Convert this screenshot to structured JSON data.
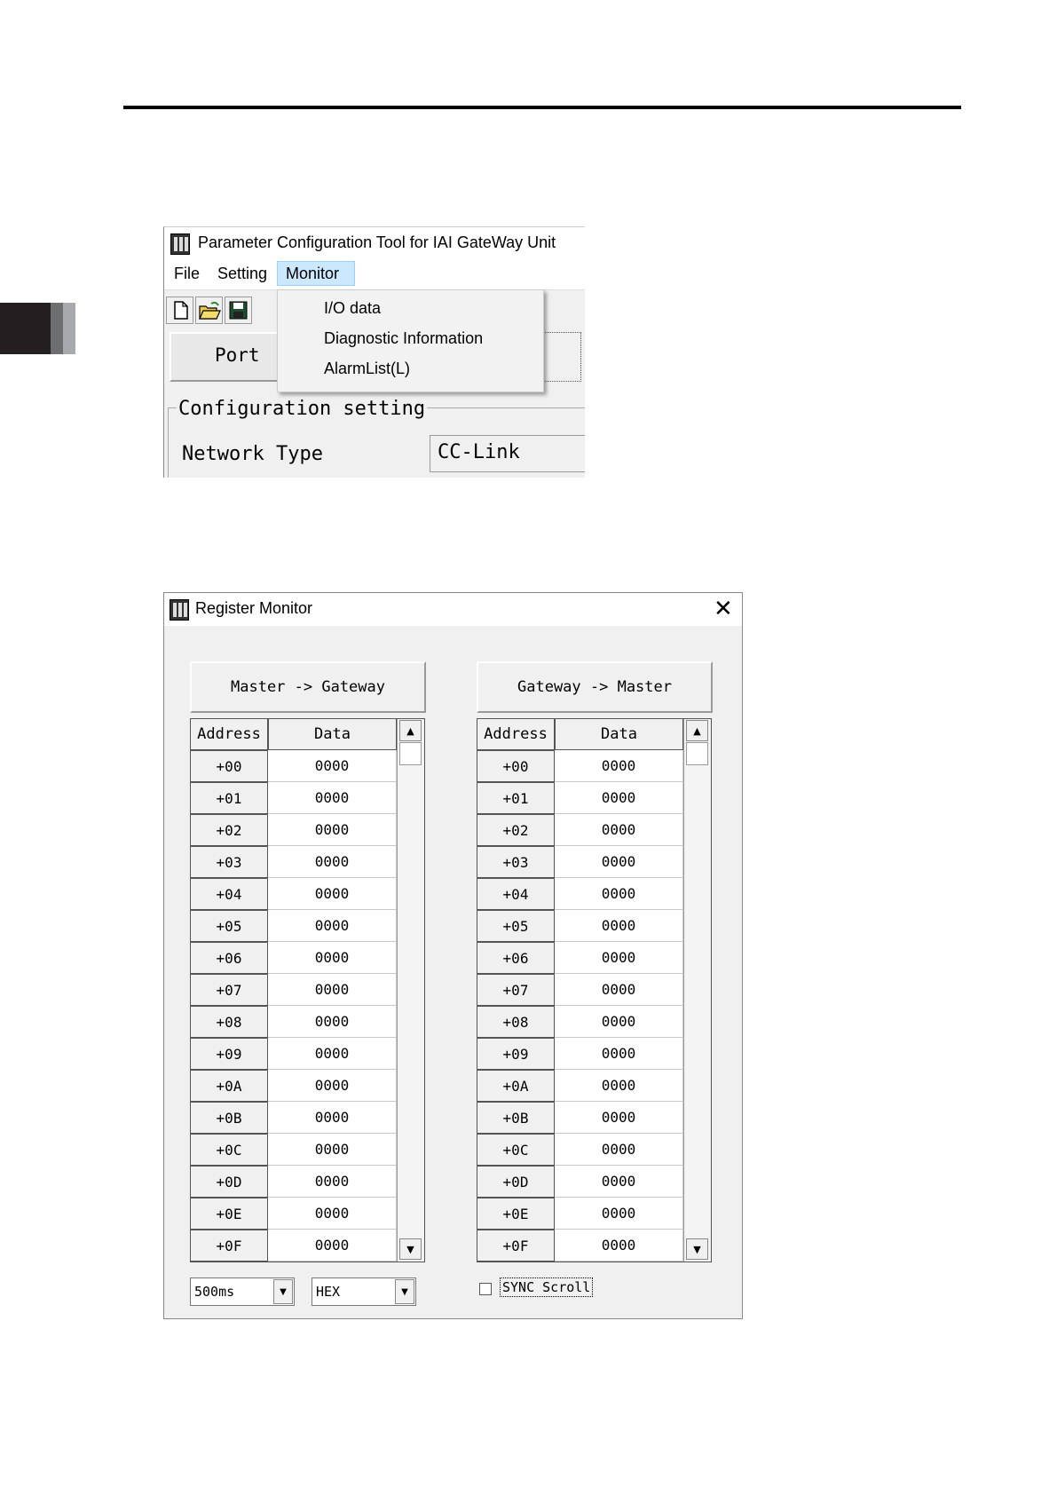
{
  "page": {
    "chapter_tab_colors": [
      "#231f20",
      "#6d6e70",
      "#a7a9ac"
    ]
  },
  "config_tool": {
    "title": "Parameter Configuration Tool for IAI GateWay Unit",
    "menu": [
      "File",
      "Setting",
      "Monitor"
    ],
    "active_menu": "Monitor",
    "toolbar_icons": [
      "new-file-icon",
      "open-folder-icon",
      "save-disk-icon"
    ],
    "port_label": "Port",
    "dropdown": [
      "I/O data",
      "Diagnostic Information",
      "AlarmList(L)"
    ],
    "group_title": "Configuration setting",
    "network_type_label": "Network Type",
    "network_type_value": "CC-Link"
  },
  "register_monitor": {
    "title": "Register Monitor",
    "close_glyph": "✕",
    "left_panel": {
      "header": "Master -> Gateway",
      "col_address": "Address",
      "col_data": "Data",
      "rows": [
        {
          "address": "+00",
          "data": "0000"
        },
        {
          "address": "+01",
          "data": "0000"
        },
        {
          "address": "+02",
          "data": "0000"
        },
        {
          "address": "+03",
          "data": "0000"
        },
        {
          "address": "+04",
          "data": "0000"
        },
        {
          "address": "+05",
          "data": "0000"
        },
        {
          "address": "+06",
          "data": "0000"
        },
        {
          "address": "+07",
          "data": "0000"
        },
        {
          "address": "+08",
          "data": "0000"
        },
        {
          "address": "+09",
          "data": "0000"
        },
        {
          "address": "+0A",
          "data": "0000"
        },
        {
          "address": "+0B",
          "data": "0000"
        },
        {
          "address": "+0C",
          "data": "0000"
        },
        {
          "address": "+0D",
          "data": "0000"
        },
        {
          "address": "+0E",
          "data": "0000"
        },
        {
          "address": "+0F",
          "data": "0000"
        }
      ]
    },
    "right_panel": {
      "header": "Gateway -> Master",
      "col_address": "Address",
      "col_data": "Data",
      "rows": [
        {
          "address": "+00",
          "data": "0000"
        },
        {
          "address": "+01",
          "data": "0000"
        },
        {
          "address": "+02",
          "data": "0000"
        },
        {
          "address": "+03",
          "data": "0000"
        },
        {
          "address": "+04",
          "data": "0000"
        },
        {
          "address": "+05",
          "data": "0000"
        },
        {
          "address": "+06",
          "data": "0000"
        },
        {
          "address": "+07",
          "data": "0000"
        },
        {
          "address": "+08",
          "data": "0000"
        },
        {
          "address": "+09",
          "data": "0000"
        },
        {
          "address": "+0A",
          "data": "0000"
        },
        {
          "address": "+0B",
          "data": "0000"
        },
        {
          "address": "+0C",
          "data": "0000"
        },
        {
          "address": "+0D",
          "data": "0000"
        },
        {
          "address": "+0E",
          "data": "0000"
        },
        {
          "address": "+0F",
          "data": "0000"
        }
      ]
    },
    "interval_select": "500ms",
    "format_select": "HEX",
    "sync_scroll_label": "SYNC Scroll",
    "sync_scroll_checked": false
  }
}
